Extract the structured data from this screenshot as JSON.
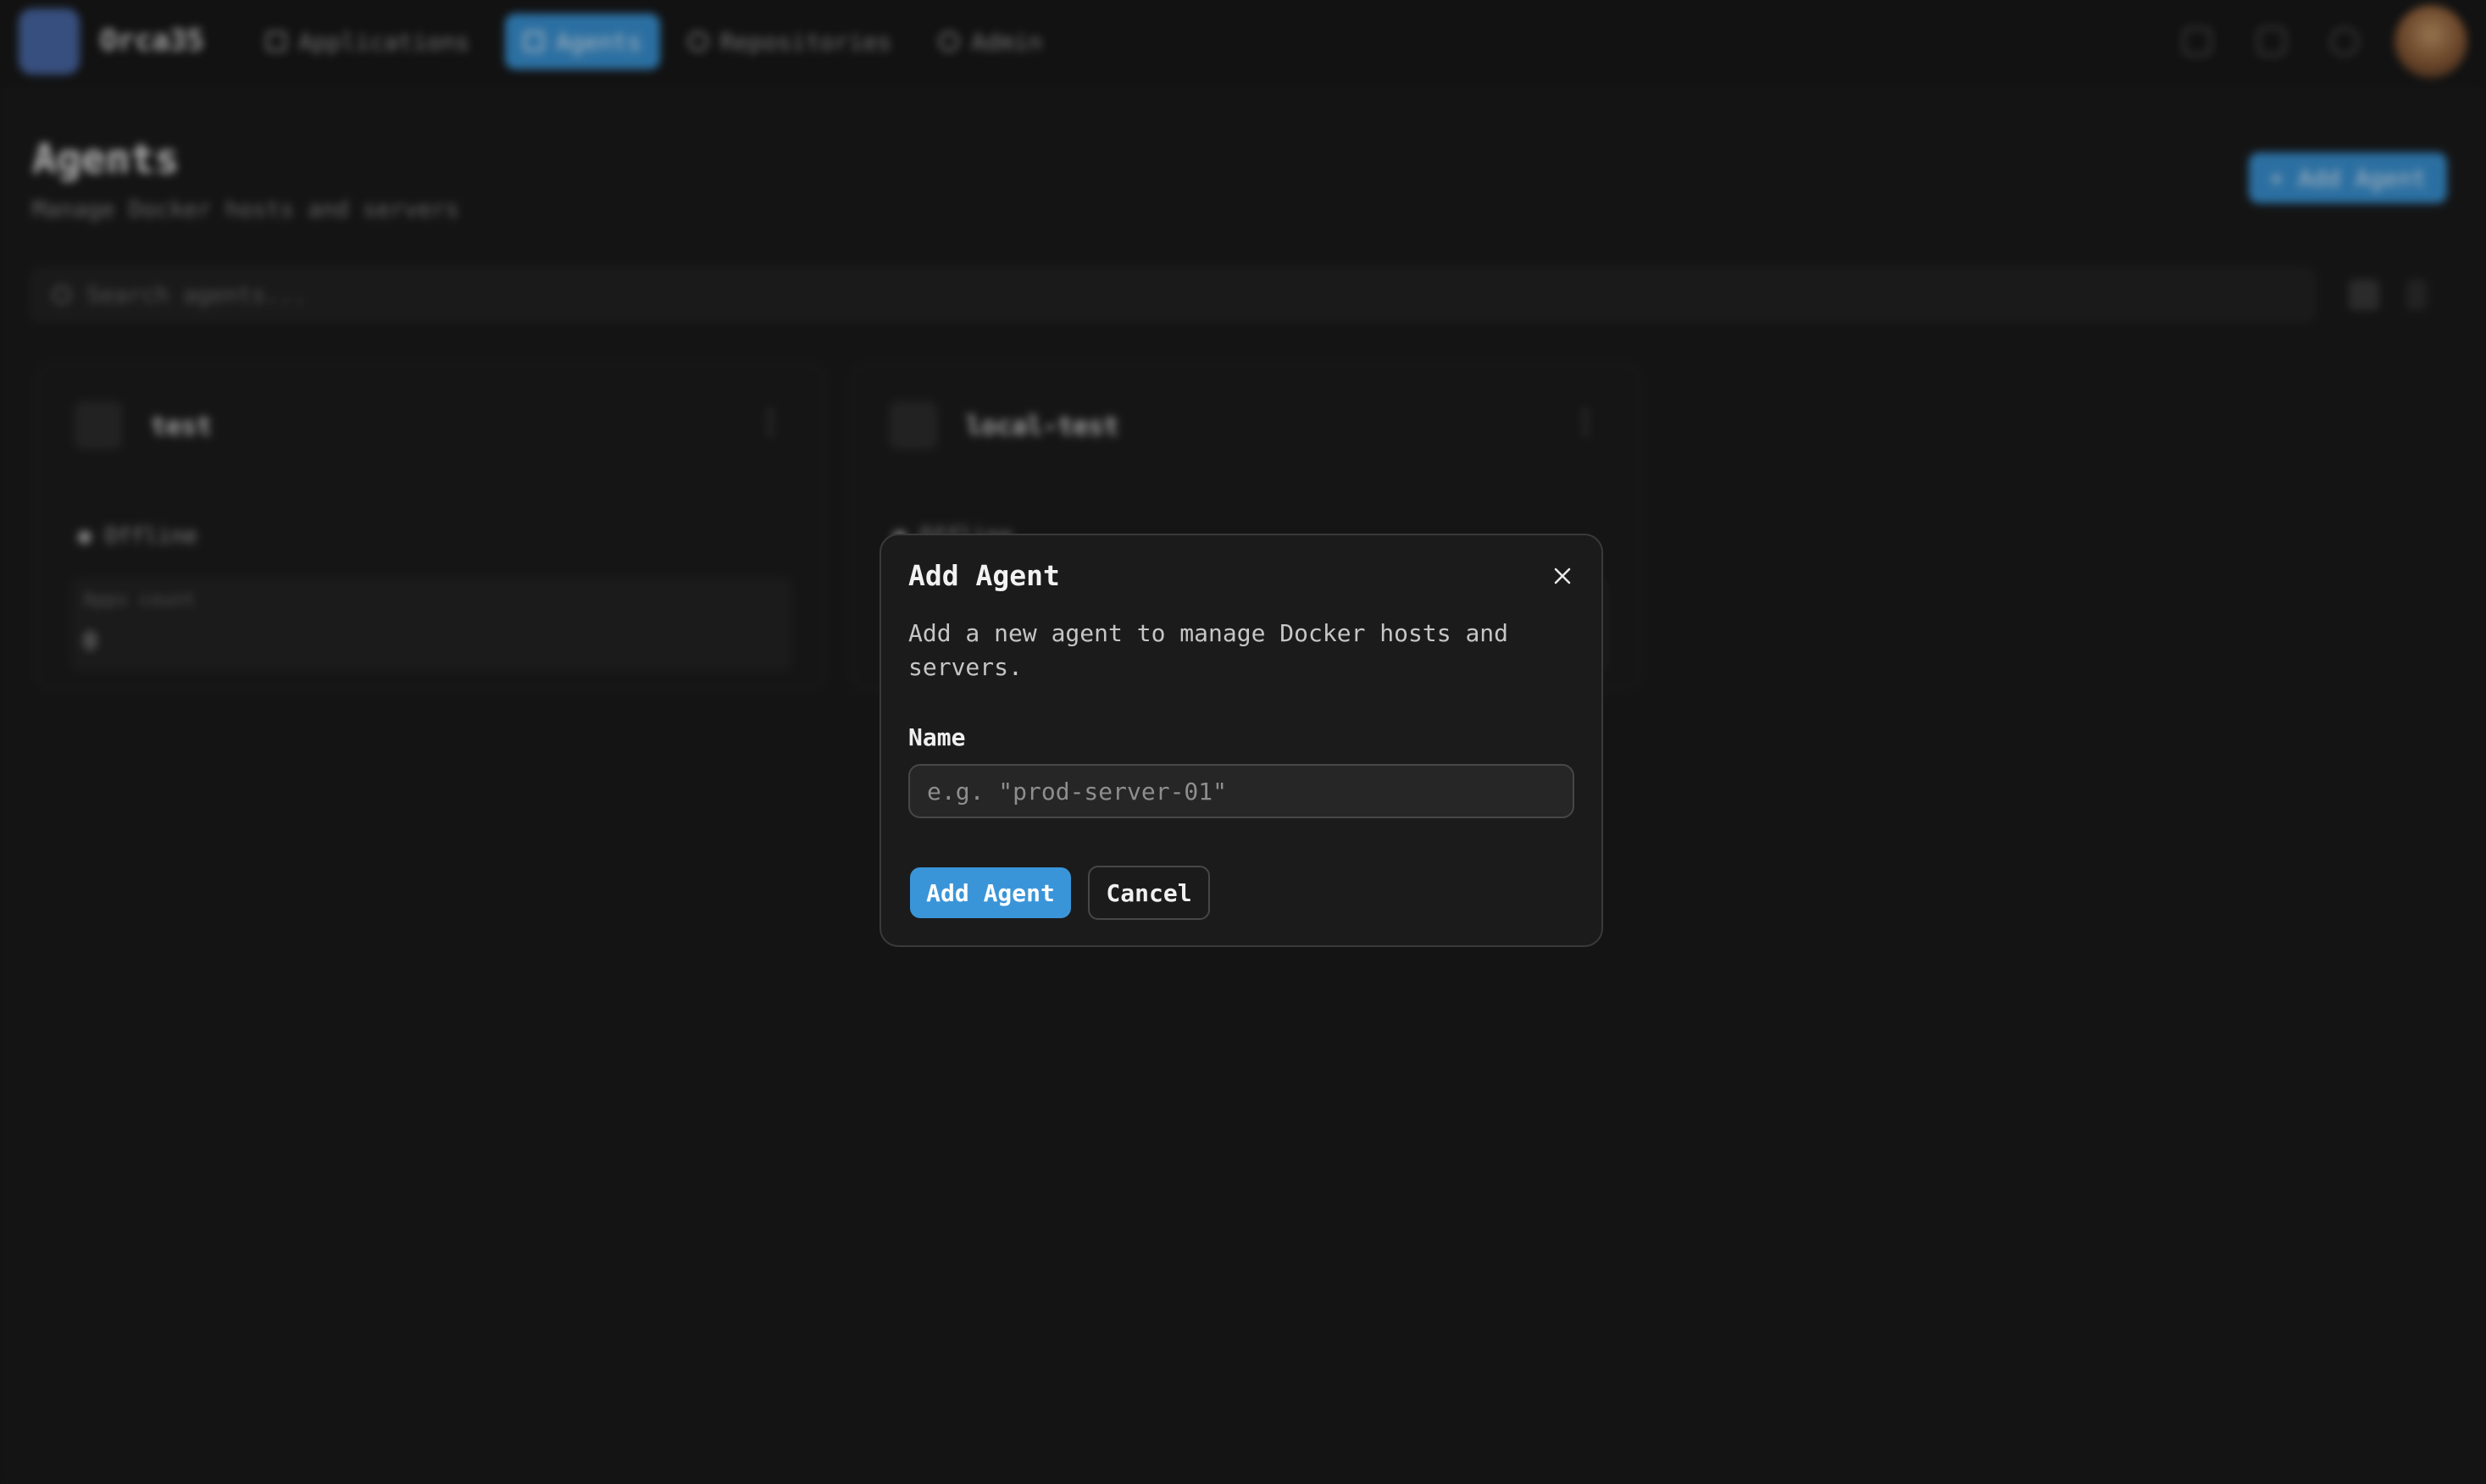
{
  "app": {
    "brand": "Orca35",
    "nav": [
      {
        "label": "Applications",
        "icon": "grid-icon"
      },
      {
        "label": "Agents",
        "icon": "server-icon",
        "active": true
      },
      {
        "label": "Repositories",
        "icon": "git-branch-icon"
      },
      {
        "label": "Admin",
        "icon": "gear-icon"
      }
    ],
    "top_icons": [
      "monitor-icon",
      "bell-icon",
      "refresh-icon"
    ]
  },
  "page": {
    "title": "Agents",
    "subtitle": "Manage Docker hosts and servers",
    "add_button": "+ Add Agent",
    "search_placeholder": "Search agents...",
    "cards": [
      {
        "title": "test",
        "status": "● Offline",
        "box_label": "Apps count",
        "box_value": "0"
      },
      {
        "title": "local-test",
        "status": "● Offline",
        "box_label": "",
        "box_value": ""
      }
    ]
  },
  "modal": {
    "title": "Add Agent",
    "description": "Add a new agent to manage Docker hosts and servers.",
    "name_label": "Name",
    "name_placeholder": "e.g. \"prod-server-01\"",
    "name_value": "",
    "primary_button": "Add Agent",
    "cancel_button": "Cancel"
  },
  "colors": {
    "accent": "#3a95d8",
    "background": "#1a1a1a",
    "modal_border": "#3a3a3a"
  }
}
